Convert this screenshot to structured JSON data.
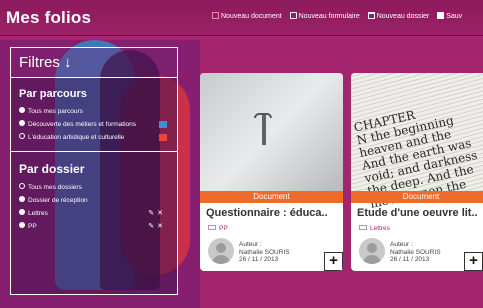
{
  "header": {
    "title": "Mes folios",
    "actions": [
      {
        "label": "Nouveau document",
        "icon": "document-icon"
      },
      {
        "label": "Nouveau formulaire",
        "icon": "form-icon"
      },
      {
        "label": "Nouveau dossier",
        "icon": "folder-icon"
      },
      {
        "label": "Sauv",
        "icon": "save-icon"
      }
    ]
  },
  "filters": {
    "title": "Filtres ↓",
    "parcours": {
      "title": "Par parcours",
      "options": [
        {
          "label": "Tous mes parcours",
          "color": ""
        },
        {
          "label": "Découverte des métiers et formations",
          "color": "#3c8fd4"
        },
        {
          "label": "L'éducation artistique et culturelle",
          "color": "#e8463c"
        }
      ]
    },
    "dossier": {
      "title": "Par dossier",
      "options": [
        {
          "label": "Tous mes dossiers"
        },
        {
          "label": "Dossier de réception"
        },
        {
          "label": "Lettres",
          "edit": "✎",
          "delete": "✕"
        },
        {
          "label": "PP",
          "edit": "✎",
          "delete": "✕"
        }
      ]
    }
  },
  "cards": [
    {
      "type": "Document",
      "title": "Questionnaire : éduca..",
      "folder": "PP",
      "author_label": "Auteur :",
      "author_name": "Nathalie SOURIS",
      "date": "26 / 11 / 2013",
      "add": "+"
    },
    {
      "type": "Document",
      "title": "Etude d'une oeuvre lit..",
      "folder": "Lettres",
      "author_label": "Auteur :",
      "author_name": "Nathalie SOURIS",
      "date": "26 / 11 / 2013",
      "add": "+",
      "image_text": "CHAPTER\nN the beginning\nheaven and the\nAnd the earth was\nvoid; and darkness\nthe deep. And the\nmoved upon the"
    }
  ],
  "colors": {
    "brand": "#a4246e",
    "accent": "#f06b2b"
  }
}
